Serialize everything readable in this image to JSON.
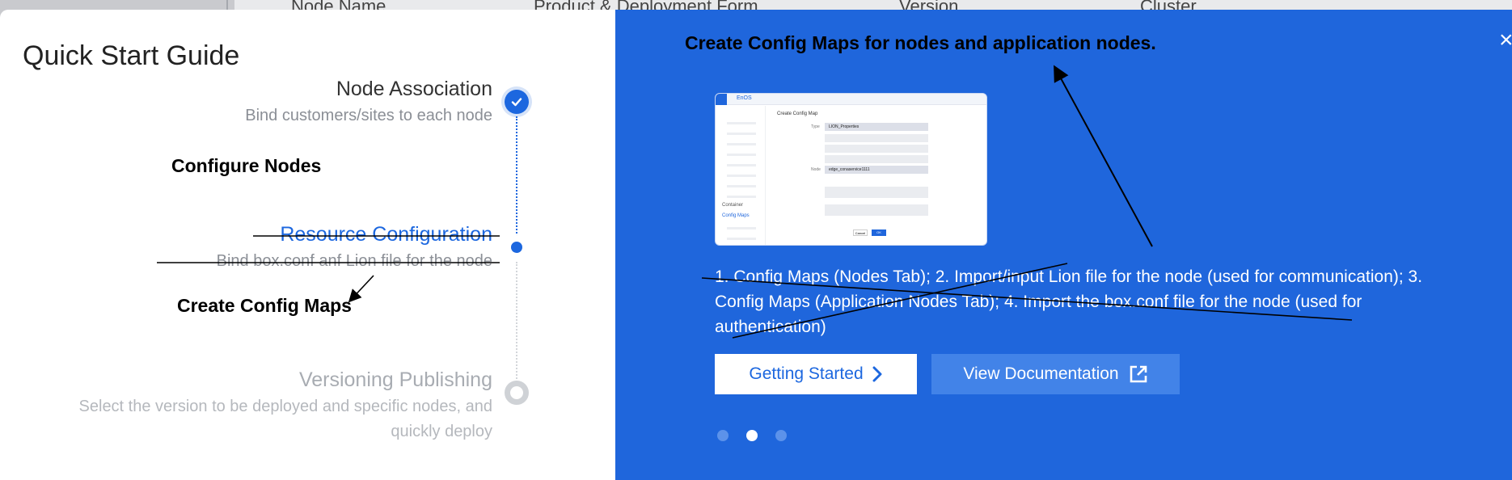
{
  "background_table": {
    "columns": [
      "Node Name",
      "Product & Deployment Form",
      "Version",
      "Cluster"
    ]
  },
  "modal": {
    "title": "Quick Start Guide",
    "steps": [
      {
        "title": "Node Association",
        "desc": "Bind customers/sites to each node",
        "state": "done"
      },
      {
        "title": "Resource Configuration",
        "desc": "Bind box.conf anf Lion file for the node",
        "state": "active"
      },
      {
        "title": "Versioning Publishing",
        "desc_line1": "Select the version to be deployed and specific nodes, and",
        "desc_line2": "quickly deploy",
        "state": "pending"
      }
    ],
    "annotations": {
      "configure_nodes": "Configure Nodes",
      "create_config_maps": "Create Config Maps",
      "panel_title": "Create Config Maps for nodes and application nodes."
    }
  },
  "panel": {
    "close_icon": "close-icon",
    "preview": {
      "logo": "EnOS",
      "form_title": "Create Config Map",
      "type_label": "Type",
      "type_value": "LION_Properties",
      "node_label": "Node",
      "node_value": "edge_conaservice1111",
      "container": "Container",
      "config_maps": "Config Maps",
      "cancel": "Cancel",
      "ok": "OK"
    },
    "description": "1. Config Maps (Nodes Tab); 2. Import/input Lion file for the node (used for communication); 3. Config Maps (Application Nodes Tab); 4. Import the box.conf file for the node (used for authentication)",
    "buttons": {
      "getting_started": "Getting Started",
      "view_documentation": "View Documentation"
    },
    "carousel": {
      "count": 3,
      "active_index": 1
    },
    "colors": {
      "panel": "#1f66dc",
      "accent": "#1c67df"
    }
  }
}
